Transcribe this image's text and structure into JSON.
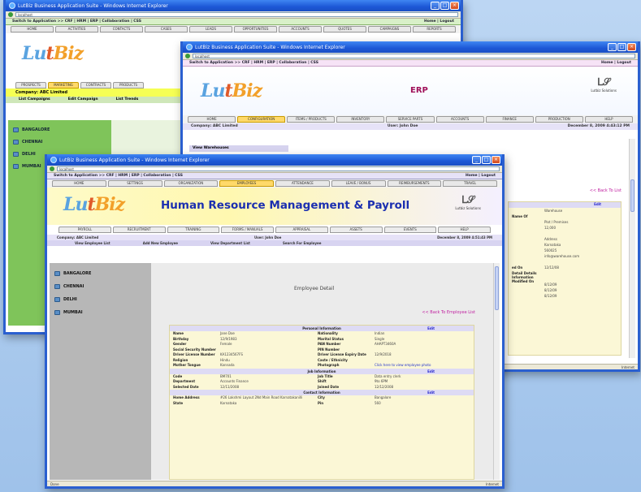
{
  "windows": {
    "crm": {
      "title": "LutBiz Business Application Suite - Windows Internet Explorer",
      "url": "localhost",
      "app_switch": "Switch to Application >> CRF | HRM | ERP | Collaboration | CSS",
      "home_links": "Home | Logout",
      "tabs": [
        "HOME",
        "ACTIVITIES",
        "CONTACTS",
        "CASES",
        "LEADS",
        "OPPORTUNITIES",
        "ACCOUNTS",
        "QUOTES",
        "CAMPAIGNS",
        "REPORTS"
      ],
      "subtabs": [
        "PROSPECTS",
        "MARKETING",
        "CONTRACTS",
        "PRODUCTS"
      ],
      "company": "Company: ABC Limited",
      "camp_row": [
        "List Campaigns",
        "Edit Campaign",
        "List Trends"
      ],
      "sidebar": [
        "BANGALORE",
        "CHENNAI",
        "DELHI",
        "MUMBAI"
      ]
    },
    "erp": {
      "title": "LutBiz Business Application Suite - Windows Internet Explorer",
      "url": "localhost",
      "app_switch": "Switch to Application >> CRF | HRM | ERP | Collaboration | CSS",
      "home_links": "Home | Logout",
      "page_title": "ERP",
      "tabs": [
        "HOME",
        "CONFIGURATION",
        "ITEMS / PRODUCTS",
        "INVENTORY",
        "SERVICE PARTS",
        "ACCOUNTS",
        "FINANCE",
        "PRODUCTION",
        "HELP"
      ],
      "company": "Company: ABC Limited",
      "user": "User: John Doe",
      "date": "December 8, 2009 4:43:12 PM",
      "side_header": "View Warehouses",
      "back_link": "<< Back To List",
      "panel_edit": "Edit",
      "panel_rows": [
        {
          "k": "",
          "v": "Warehouse"
        },
        {
          "k": "Name Of",
          "v": ""
        },
        {
          "k": "",
          "v": "Plot / Premises"
        },
        {
          "k": "",
          "v": "12,000"
        },
        {
          "k": "",
          "v": ""
        },
        {
          "k": "",
          "v": "Address"
        },
        {
          "k": "",
          "v": "Karnataka"
        },
        {
          "k": "",
          "v": "560025"
        },
        {
          "k": "",
          "v": "info@warehouse.com"
        },
        {
          "k": "",
          "v": ""
        },
        {
          "k": "ed On",
          "v": "12/12/08"
        },
        {
          "k": "Detail Details",
          "v": ""
        },
        {
          "k": "Information Modified On",
          "v": ""
        },
        {
          "k": "",
          "v": "8/12/09"
        },
        {
          "k": "",
          "v": "8/12/09"
        },
        {
          "k": "",
          "v": "8/12/09"
        }
      ],
      "status": "Internet"
    },
    "hrm": {
      "title": "LutBiz Business Application Suite - Windows Internet Explorer",
      "url": "localhost",
      "app_switch": "Switch to Application >> CRF | HRM | ERP | Collaboration | CSS",
      "home_links": "Home | Logout",
      "tabs": [
        "HOME",
        "SETTINGS",
        "ORGANIZATION",
        "EMPLOYEES",
        "ATTENDANCE",
        "LEAVE / BONUS",
        "REIMBURSEMENTS",
        "TRAVEL"
      ],
      "page_title": "Human Resource Management & Payroll",
      "sub_tabs": [
        "PAYROLL",
        "RECRUITMENT",
        "TRAINING",
        "FORMS / MANUALS",
        "APPRAISAL",
        "ASSETS",
        "EVENTS",
        "HELP"
      ],
      "company": "Company: ABC Limited",
      "user": "User: John Doe",
      "date": "December 8, 2009 4:51:43 PM",
      "info_links": [
        "View Employee List",
        "Add New Employee",
        "View Department List",
        "Search For Employee"
      ],
      "sidebar": [
        "BANGALORE",
        "CHENNAI",
        "DELHI",
        "MUMBAI"
      ],
      "employee_title": "Employee Detail",
      "back_link": "<< Back To Employee List",
      "sections": [
        {
          "title": "Personal Information",
          "edit": "Edit",
          "rows": [
            {
              "k": "Name",
              "v": "Jane Doe",
              "k2": "Nationality",
              "v2": "Indian"
            },
            {
              "k": "Birthday",
              "v": "12/9/1983",
              "k2": "Marital Status",
              "v2": "Single"
            },
            {
              "k": "Gender",
              "v": "Female",
              "k2": "PAN Number",
              "v2": "AHAPT3460A"
            },
            {
              "k": "Social Security Number",
              "v": "",
              "k2": "PIN Number",
              "v2": ""
            },
            {
              "k": "Driver License Number",
              "v": "KA1234567FS",
              "k2": "Driver License Expiry Date",
              "v2": "12/9/2018"
            },
            {
              "k": "Religion",
              "v": "Hindu",
              "k2": "Caste / Ethnicity",
              "v2": ""
            },
            {
              "k": "Mother Tongue",
              "v": "Kannada",
              "k2": "Photograph",
              "v2": "Click here to view employee photo"
            }
          ]
        },
        {
          "title": "Job Information",
          "edit": "Edit",
          "rows": [
            {
              "k": "Code",
              "v": "BM701",
              "k2": "Job Title",
              "v2": "Data entry clerk"
            },
            {
              "k": "Department",
              "v": "Accounts Finance",
              "k2": "Shift",
              "v2": "9to 6PM"
            },
            {
              "k": "Selected Date",
              "v": "12/11/2008",
              "k2": "Joined Date",
              "v2": "12/12/2008"
            }
          ]
        },
        {
          "title": "Contact Information",
          "edit": "Edit",
          "rows": [
            {
              "k": "Home Address",
              "v": "#26 Lakshmi Layout 2Nd Main Road Karnatakanilli",
              "k2": "City",
              "v2": "Bangalore"
            },
            {
              "k": "State",
              "v": "Karnataka",
              "k2": "Pin",
              "v2": "560"
            }
          ]
        }
      ],
      "status_left": "Done",
      "status_right": "Internet"
    }
  },
  "logo": {
    "part1": "Lu",
    "part2": "t",
    "part3": "Biz"
  },
  "corp_label": "Lutbiz Solutions",
  "colors": {
    "accent": "#1b2fb0",
    "title_bar": "#1c57d6",
    "highlight": "#f6ff54",
    "active_tab": "#ffd96a"
  }
}
